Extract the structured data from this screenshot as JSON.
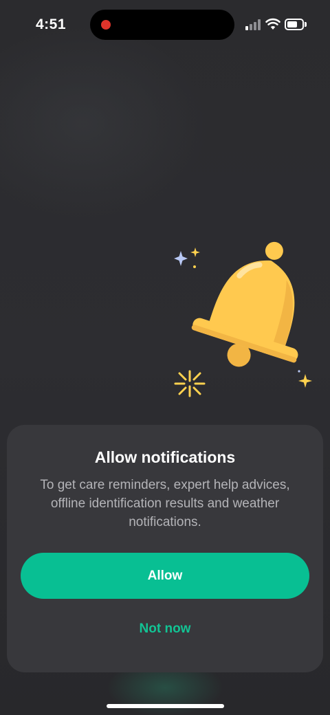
{
  "status_bar": {
    "time": "4:51",
    "recording_color": "#e0342b",
    "icons": [
      "signal-icon",
      "wifi-icon",
      "battery-icon"
    ]
  },
  "illustration": {
    "icon": "bell-icon",
    "bell_color": "#ffc94f"
  },
  "dialog": {
    "title": "Allow notifications",
    "description": "To get care reminders, expert help advices, offline identification results and weather notifications.",
    "allow_label": "Allow",
    "not_now_label": "Not now"
  },
  "colors": {
    "accent": "#08bf93",
    "sheet_background": "#38383c",
    "screen_background": "#2a2a2d"
  }
}
